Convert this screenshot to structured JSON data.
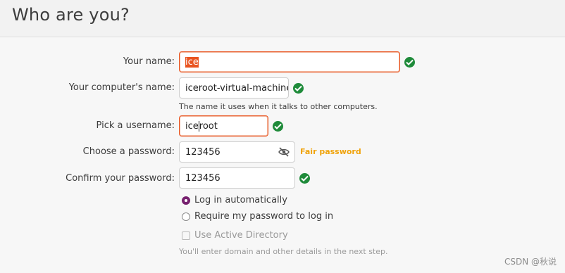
{
  "header": {
    "title": "Who are you?"
  },
  "form": {
    "name": {
      "label": "Your name:",
      "value": "ice"
    },
    "computer": {
      "label": "Your computer's name:",
      "value": "iceroot-virtual-machine",
      "hint": "The name it uses when it talks to other computers."
    },
    "username": {
      "label": "Pick a username:",
      "value_before_caret": "ice",
      "value_after_caret": "root"
    },
    "password": {
      "label": "Choose a password:",
      "value": "123456",
      "strength": "Fair password"
    },
    "confirm": {
      "label": "Confirm your password:",
      "value": "123456"
    }
  },
  "login_options": {
    "auto": "Log in automatically",
    "require": "Require my password to log in",
    "selected": "auto"
  },
  "active_directory": {
    "label": "Use Active Directory",
    "hint": "You'll enter domain and other details in the next step."
  },
  "watermark": "CSDN @秋说",
  "colors": {
    "accent": "#e95420",
    "valid": "#1f8b3a",
    "radio": "#77216f",
    "warning": "#f0a30a"
  },
  "icons": {
    "valid": "check-circle-icon",
    "visibility": "eye-off-icon"
  }
}
